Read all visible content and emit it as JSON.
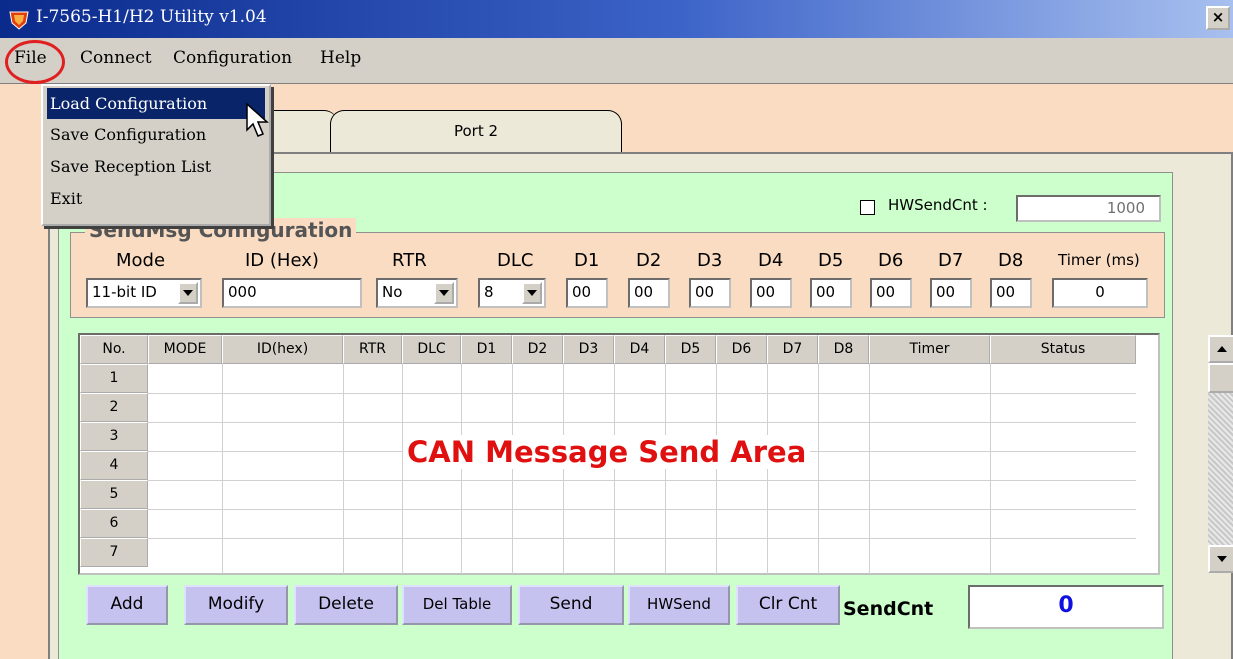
{
  "window": {
    "title": "I-7565-H1/H2 Utility v1.04",
    "close_label": "×"
  },
  "menu": {
    "items": [
      "File",
      "Connect",
      "Configuration",
      "Help"
    ]
  },
  "file_menu": {
    "items": [
      "Load Configuration",
      "Save Configuration",
      "Save Reception List",
      "Exit"
    ],
    "selected_index": 0
  },
  "tabs": {
    "port1": "",
    "port2": "Port 2"
  },
  "group": {
    "title_visible": "g"
  },
  "hw": {
    "checkbox_label": "HWSendCnt :",
    "value": "1000",
    "checked": false
  },
  "sendmsg": {
    "title": "SendMsg Configuration",
    "labels": {
      "mode": "Mode",
      "id": "ID (Hex)",
      "rtr": "RTR",
      "dlc": "DLC",
      "d1": "D1",
      "d2": "D2",
      "d3": "D3",
      "d4": "D4",
      "d5": "D5",
      "d6": "D6",
      "d7": "D7",
      "d8": "D8",
      "timer": "Timer (ms)"
    },
    "values": {
      "mode": "11-bit ID",
      "id": "000",
      "rtr": "No",
      "dlc": "8",
      "d1": "00",
      "d2": "00",
      "d3": "00",
      "d4": "00",
      "d5": "00",
      "d6": "00",
      "d7": "00",
      "d8": "00",
      "timer": "0"
    }
  },
  "table": {
    "headers": [
      "No.",
      "MODE",
      "ID(hex)",
      "RTR",
      "DLC",
      "D1",
      "D2",
      "D3",
      "D4",
      "D5",
      "D6",
      "D7",
      "D8",
      "Timer",
      "Status"
    ],
    "rows": [
      "1",
      "2",
      "3",
      "4",
      "5",
      "6",
      "7"
    ],
    "overlay_label": "CAN Message Send Area"
  },
  "buttons": {
    "add": "Add",
    "modify": "Modify",
    "delete": "Delete",
    "del_table": "Del Table",
    "send": "Send",
    "hwsend": "HWSend",
    "clr_cnt": "Clr Cnt"
  },
  "sendcnt": {
    "label": "SendCnt",
    "value": "0"
  },
  "colors": {
    "title_bar": "#0a2a8c",
    "background": "#f9dcc2",
    "group_bg": "#ccffcc",
    "button_bg": "#c6c2f0",
    "highlight": "#e01010",
    "counter": "#1010e0"
  }
}
